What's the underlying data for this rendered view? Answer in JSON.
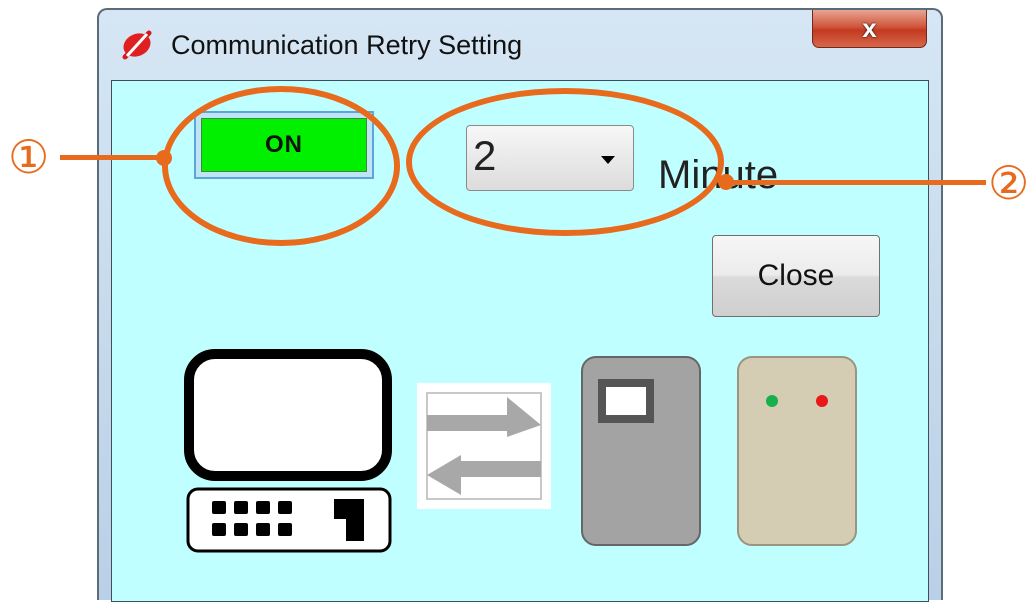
{
  "window": {
    "title": "Communication Retry Setting",
    "close_glyph": "x"
  },
  "toggle": {
    "label": "ON",
    "state": "on",
    "color": "#00f000"
  },
  "retry_interval": {
    "selected": "2",
    "unit_label": "Minute"
  },
  "close_button": {
    "label": "Close"
  },
  "callouts": [
    {
      "number": "①",
      "target": "on-button"
    },
    {
      "number": "②",
      "target": "minute-select"
    }
  ],
  "colors": {
    "client_background": "#c0ffff",
    "annotation": "#e86a1c",
    "title_close": "#c9452a"
  },
  "icons": [
    "app-logo-icon",
    "computer-icon",
    "transfer-arrows-icon",
    "terminal-device-icon",
    "controller-device-icon"
  ]
}
